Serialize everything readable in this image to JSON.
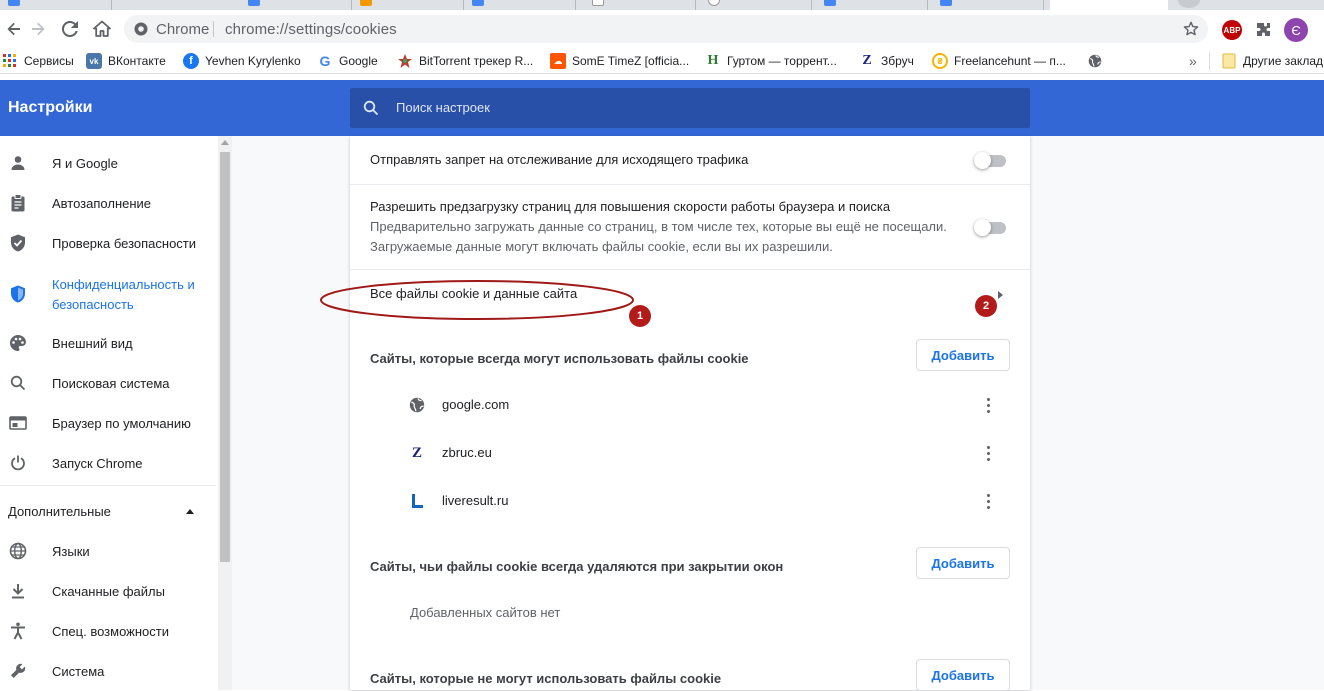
{
  "browser": {
    "omnibox": {
      "site_name": "Chrome",
      "url": "chrome://settings/cookies"
    },
    "avatar_letter": "Є",
    "extension_abp_label": "ABP",
    "bookmarks": [
      {
        "label": "Сервисы",
        "icon": "apps-grid-icon"
      },
      {
        "label": "ВКонтакте",
        "icon": "vk-icon"
      },
      {
        "label": "Yevhen Kyrylenko",
        "icon": "facebook-icon"
      },
      {
        "label": "Google",
        "icon": "google-icon"
      },
      {
        "label": "BitTorrent трекер R...",
        "icon": "rutracker-icon"
      },
      {
        "label": "SomE TimeZ [officia...",
        "icon": "soundcloud-icon"
      },
      {
        "label": "Гуртом — торрент...",
        "icon": "hurtom-icon"
      },
      {
        "label": "Збруч",
        "icon": "zbruc-icon"
      },
      {
        "label": "Freelancehunt — п...",
        "icon": "freelancehunt-icon"
      },
      {
        "label": "",
        "icon": "globe-icon"
      }
    ],
    "bookmarks_overflow": "»",
    "other_bookmarks": "Другие заклад"
  },
  "header": {
    "title": "Настройки",
    "search_placeholder": "Поиск настроек"
  },
  "sidebar": {
    "items": [
      {
        "label": "Я и Google",
        "icon": "person-icon"
      },
      {
        "label": "Автозаполнение",
        "icon": "clipboard-icon"
      },
      {
        "label": "Проверка безопасности",
        "icon": "shield-check-icon"
      },
      {
        "label": "Конфиденциальность и безопасность",
        "icon": "privacy-shield-icon",
        "selected": true
      },
      {
        "label": "Внешний вид",
        "icon": "palette-icon"
      },
      {
        "label": "Поисковая система",
        "icon": "search-icon"
      },
      {
        "label": "Браузер по умолчанию",
        "icon": "browser-window-icon"
      },
      {
        "label": "Запуск Chrome",
        "icon": "power-icon"
      }
    ],
    "advanced_label": "Дополнительные",
    "advanced_items": [
      {
        "label": "Языки",
        "icon": "globe-icon"
      },
      {
        "label": "Скачанные файлы",
        "icon": "download-icon"
      },
      {
        "label": "Спец. возможности",
        "icon": "accessibility-icon"
      },
      {
        "label": "Система",
        "icon": "wrench-icon"
      }
    ]
  },
  "settings": {
    "do_not_track": {
      "label": "Отправлять запрет на отслеживание для исходящего трафика",
      "enabled": false
    },
    "preload": {
      "label": "Разрешить предзагрузку страниц для повышения скорости работы браузера и поиска",
      "sub1": "Предварительно загружать данные со страниц, в том числе тех, которые вы ещё не посещали.",
      "sub2": "Загружаемые данные могут включать файлы cookie, если вы их разрешили.",
      "enabled": false
    },
    "all_cookies_label": "Все файлы cookie и данные сайта",
    "always_allow": {
      "title": "Сайты, которые всегда могут использовать файлы cookie",
      "add_label": "Добавить",
      "sites": [
        {
          "domain": "google.com",
          "icon": "globe-icon"
        },
        {
          "domain": "zbruc.eu",
          "icon": "zbruc-icon"
        },
        {
          "domain": "liveresult.ru",
          "icon": "liveresult-icon"
        }
      ]
    },
    "clear_on_exit": {
      "title": "Сайты, чьи файлы cookie всегда удаляются при закрытии окон",
      "add_label": "Добавить",
      "empty_text": "Добавленных сайтов нет"
    },
    "never_allow": {
      "title": "Сайты, которые не могут использовать файлы cookie",
      "add_label": "Добавить"
    }
  },
  "annotations": {
    "marker_1": "1",
    "marker_2": "2"
  },
  "colors": {
    "header": "#3367d6",
    "accent": "#1a73e8",
    "annotation": "#b31b1b"
  }
}
